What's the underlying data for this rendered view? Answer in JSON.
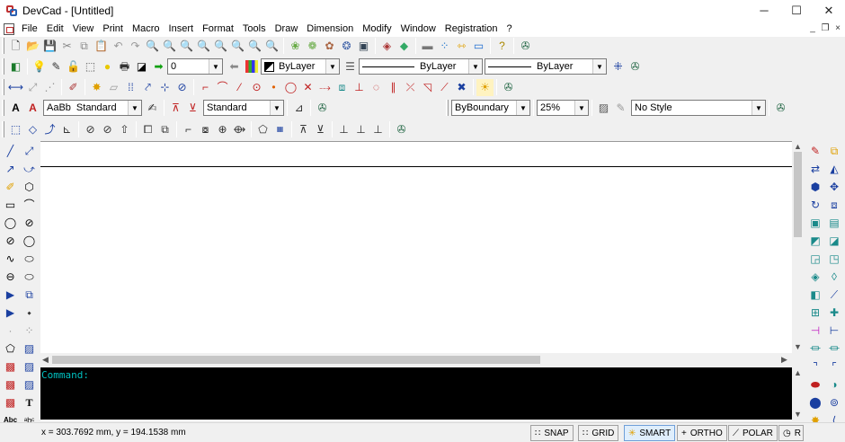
{
  "window": {
    "title": "DevCad - [Untitled]",
    "controls": {
      "minimize": "─",
      "maximize": "☐",
      "close": "✕"
    }
  },
  "menu": {
    "items": [
      "File",
      "Edit",
      "View",
      "Print",
      "Macro",
      "Insert",
      "Format",
      "Tools",
      "Draw",
      "Dimension",
      "Modify",
      "Window",
      "Registration",
      "?"
    ],
    "mdi_controls": {
      "minimize": "_",
      "restore": "❐",
      "close": "×"
    }
  },
  "toolbar_layer": {
    "layer_value": "0",
    "color_value": "ByLayer",
    "linetype_value": "ByLayer",
    "lineweight_value": "ByLayer"
  },
  "toolbar_text": {
    "style_preview": "AaBb",
    "text_style_value": "Standard",
    "dim_style_value": "Standard",
    "hatch_boundary_value": "ByBoundary",
    "transparency_value": "25%",
    "plot_style_value": "No Style"
  },
  "command": {
    "prompt": "Command:"
  },
  "palette_left": {
    "text_a": "T",
    "text_b": "Abc",
    "text_c": "ᵃbᶜ"
  },
  "status": {
    "coordinates": "x = 303.7692 mm, y = 194.1538 mm",
    "buttons": [
      {
        "label": "SNAP",
        "icon": "∷",
        "active": false
      },
      {
        "label": "GRID",
        "icon": "∷",
        "active": false
      },
      {
        "label": "SMART",
        "icon": "✳",
        "active": true
      },
      {
        "label": "ORTHO",
        "icon": "+",
        "active": false
      },
      {
        "label": "POLAR",
        "icon": "⟋",
        "active": false
      },
      {
        "label": "R",
        "icon": "◷",
        "active": false
      }
    ]
  },
  "colors": {
    "canvas": "#ffffff",
    "command_bg": "#000000",
    "command_text": "#00c0c0",
    "chrome": "#f0f0f0",
    "active_toggle": "#dfeefc"
  }
}
